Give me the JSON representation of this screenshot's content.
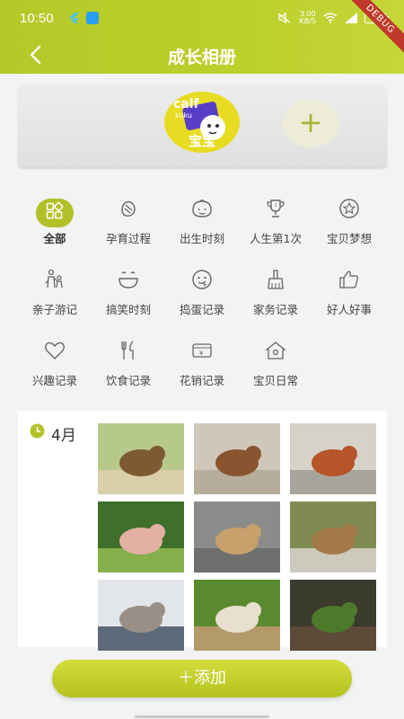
{
  "status_bar": {
    "time": "10:50",
    "net_speed": "3.00",
    "net_unit": "KB/S",
    "debug_banner": "DEBUG"
  },
  "header": {
    "title": "成长相册"
  },
  "profile": {
    "avatar_name": "宝宝",
    "avatar_logo_text": "calf",
    "avatar_logo_sub": "kuku",
    "add_symbol": "+"
  },
  "categories": [
    {
      "label": "全部",
      "icon": "grid-icon",
      "active": true
    },
    {
      "label": "孕育过程",
      "icon": "pregnancy-icon"
    },
    {
      "label": "出生时刻",
      "icon": "baby-face-icon"
    },
    {
      "label": "人生第1次",
      "icon": "trophy-icon"
    },
    {
      "label": "宝贝梦想",
      "icon": "star-icon"
    },
    {
      "label": "亲子游记",
      "icon": "family-icon"
    },
    {
      "label": "搞笑时刻",
      "icon": "laugh-icon"
    },
    {
      "label": "捣蛋记录",
      "icon": "mischief-icon"
    },
    {
      "label": "家务记录",
      "icon": "broom-icon"
    },
    {
      "label": "好人好事",
      "icon": "thumbs-up-icon"
    },
    {
      "label": "兴趣记录",
      "icon": "heart-icon"
    },
    {
      "label": "饮食记录",
      "icon": "cutlery-icon"
    },
    {
      "label": "花销记录",
      "icon": "money-icon"
    },
    {
      "label": "宝贝日常",
      "icon": "home-icon"
    }
  ],
  "album": {
    "month": "4月",
    "photos": [
      {
        "subject": "chipmunk",
        "colors": [
          "#b7c98a",
          "#7d5a33",
          "#d9cfa9"
        ]
      },
      {
        "subject": "fox-cubs",
        "colors": [
          "#cfc7b9",
          "#8a5430",
          "#b7ad9b"
        ]
      },
      {
        "subject": "fox",
        "colors": [
          "#d6d2c8",
          "#b6542a",
          "#a7a59b"
        ]
      },
      {
        "subject": "piglet",
        "colors": [
          "#3f6f2a",
          "#e3b0a3",
          "#86b04c"
        ]
      },
      {
        "subject": "sea-lion-pup",
        "colors": [
          "#8a8c8a",
          "#c7a06c",
          "#6f706d"
        ]
      },
      {
        "subject": "fox-kit-eating",
        "colors": [
          "#7f8b52",
          "#a57a4a",
          "#cdc9bd"
        ]
      },
      {
        "subject": "kitten",
        "colors": [
          "#e2e6ea",
          "#9a8f86",
          "#5e6a7a"
        ]
      },
      {
        "subject": "puppies-lawn",
        "colors": [
          "#5a8a2f",
          "#e8dfcf",
          "#b49a6a"
        ]
      },
      {
        "subject": "otter-water",
        "colors": [
          "#3a3b2c",
          "#4d7a2a",
          "#5e4a38"
        ]
      }
    ]
  },
  "footer": {
    "add_label": "＋添加"
  }
}
